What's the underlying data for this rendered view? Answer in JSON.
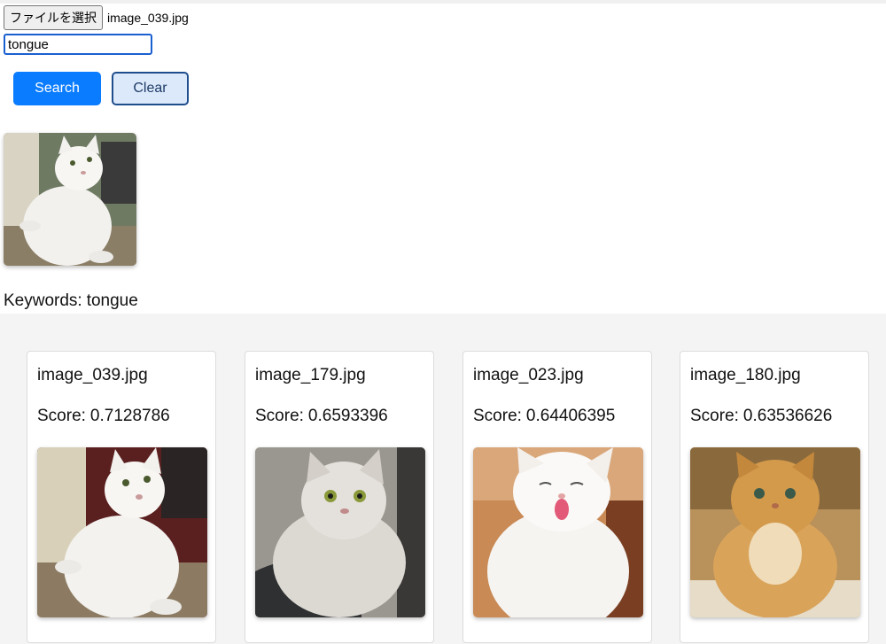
{
  "upload": {
    "choose_button_label": "ファイルを選択",
    "selected_file": "image_039.jpg"
  },
  "search": {
    "keyword_value": "tongue",
    "search_button_label": "Search",
    "clear_button_label": "Clear"
  },
  "preview": {
    "image_icon": "white-persian-cat-photo"
  },
  "keywords": {
    "prefix": "Keywords:",
    "value": "tongue"
  },
  "score_prefix": "Score:",
  "results": [
    {
      "name": "image_039.jpg",
      "score": "0.7128786",
      "image_icon": "white-cat-looking-up-photo"
    },
    {
      "name": "image_179.jpg",
      "score": "0.6593396",
      "image_icon": "grey-fluffy-cat-photo"
    },
    {
      "name": "image_023.jpg",
      "score": "0.64406395",
      "image_icon": "white-cat-tongue-out-photo"
    },
    {
      "name": "image_180.jpg",
      "score": "0.63536626",
      "image_icon": "orange-fluffy-cat-photo"
    }
  ],
  "colors": {
    "primary": "#0a7cff",
    "clear_bg": "#dbe9fb",
    "clear_border": "#1f4e8c",
    "results_bg": "#f4f4f4"
  }
}
